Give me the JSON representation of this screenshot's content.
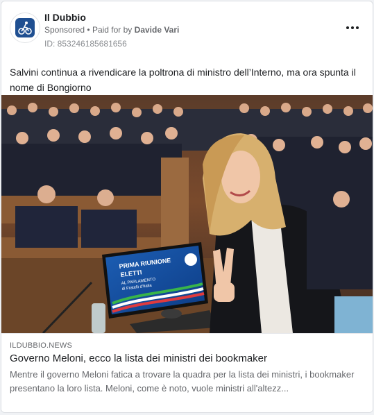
{
  "post": {
    "page_name": "Il Dubbio",
    "sponsored_label": "Sponsored",
    "separator": "•",
    "paid_prefix": "Paid for by",
    "paid_by": "Davide Vari",
    "post_id": "ID: 853246185681656",
    "text": "Salvini continua a rivendicare la poltrona di ministro dell’Interno, ma ora spunta il nome di Bongiorno"
  },
  "image": {
    "screen_line1": "PRIMA RIUNIONE",
    "screen_line2": "ELETTI",
    "screen_line3": "AL PARLAMENTO",
    "screen_line4": "di Fratelli d'Italia"
  },
  "link": {
    "domain": "ILDUBBIO.NEWS",
    "headline": "Governo Meloni, ecco la lista dei ministri dei bookmaker",
    "description": "Mentre il governo Meloni fatica a trovare la quadra per la lista dei ministri, i bookmaker presentano la loro lista. Meloni, come è noto, vuole ministri all'altezz..."
  },
  "icons": {
    "page_logo": "cyclist-logo-icon",
    "more": "more-options-icon"
  },
  "colors": {
    "logo_bg": "#1f4f91",
    "text_primary": "#1c1e21",
    "text_secondary": "#65676b"
  }
}
